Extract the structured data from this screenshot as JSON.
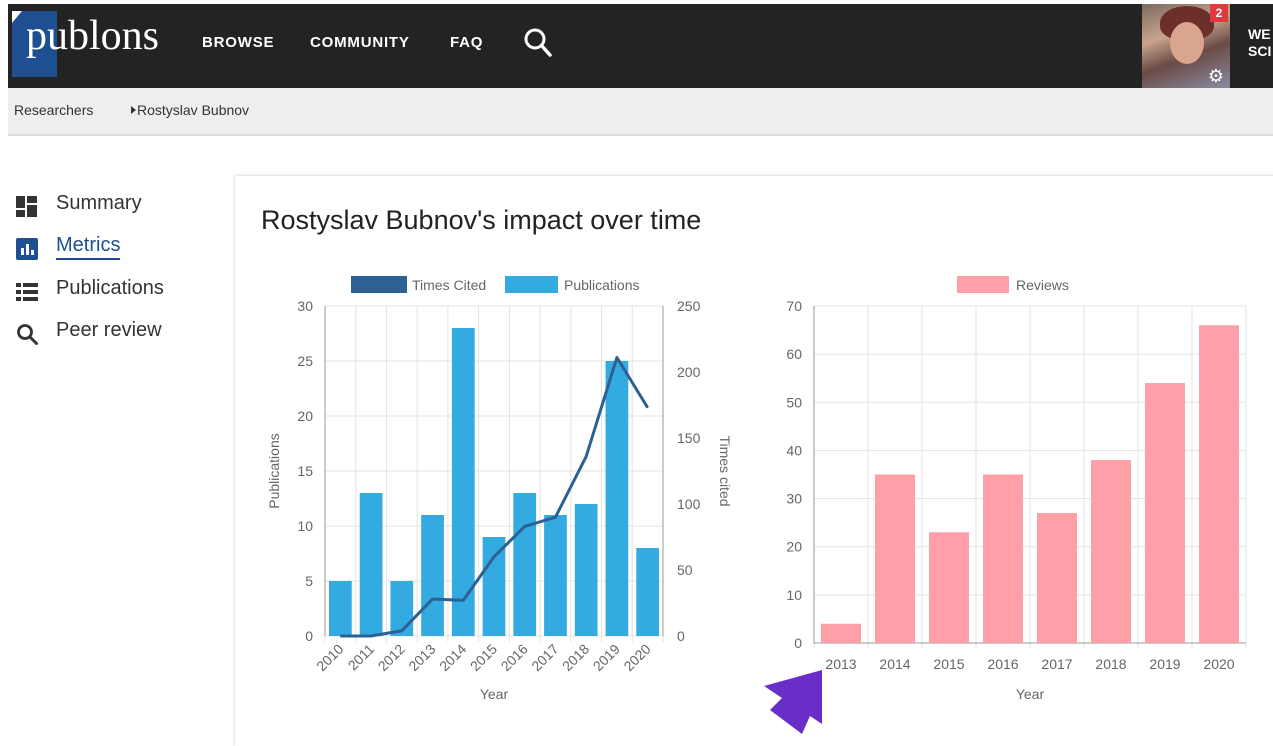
{
  "nav": {
    "logo": "publons",
    "links": [
      "BROWSE",
      "COMMUNITY",
      "FAQ"
    ],
    "notification_count": "2",
    "user_partial": "WE\nSCI"
  },
  "breadcrumb": [
    "Researchers",
    "Rostyslav Bubnov"
  ],
  "sidebar": {
    "items": [
      {
        "label": "Summary",
        "icon": "dashboard-icon"
      },
      {
        "label": "Metrics",
        "icon": "bar-chart-icon",
        "active": true
      },
      {
        "label": "Publications",
        "icon": "list-icon"
      },
      {
        "label": "Peer review",
        "icon": "search-icon"
      }
    ]
  },
  "card": {
    "title": "Rostyslav Bubnov's impact over time"
  },
  "colors": {
    "nav_bg": "#232323",
    "brand": "#1d4f91",
    "publications": "#33abe0",
    "times_cited": "#2d6093",
    "reviews": "#ff9fa8",
    "pointer": "#6a2ec8"
  },
  "chart_data": [
    {
      "type": "bar",
      "categories": [
        "2010",
        "2011",
        "2012",
        "2013",
        "2014",
        "2015",
        "2016",
        "2017",
        "2018",
        "2019",
        "2020"
      ],
      "series": [
        {
          "name": "Publications",
          "type": "bar",
          "axis": "left",
          "values": [
            5,
            13,
            5,
            11,
            28,
            9,
            13,
            11,
            12,
            25,
            8
          ]
        },
        {
          "name": "Times Cited",
          "type": "line",
          "axis": "right",
          "values": [
            0,
            0,
            4,
            28,
            27,
            60,
            83,
            90,
            136,
            211,
            173
          ]
        }
      ],
      "xlabel": "Year",
      "ylabel": "Publications",
      "y2label": "Times cited",
      "ylim": [
        0,
        30
      ],
      "y2lim": [
        0,
        250
      ],
      "yticks": [
        0,
        5,
        10,
        15,
        20,
        25,
        30
      ],
      "y2ticks": [
        0,
        50,
        100,
        150,
        200,
        250
      ],
      "legend": "top",
      "grid": true
    },
    {
      "type": "bar",
      "categories": [
        "2013",
        "2014",
        "2015",
        "2016",
        "2017",
        "2018",
        "2019",
        "2020"
      ],
      "series": [
        {
          "name": "Reviews",
          "values": [
            4,
            35,
            23,
            35,
            27,
            38,
            54,
            66
          ]
        }
      ],
      "xlabel": "Year",
      "ylim": [
        0,
        70
      ],
      "yticks": [
        0,
        10,
        20,
        30,
        40,
        50,
        60,
        70
      ],
      "legend": "top",
      "grid": true
    }
  ]
}
